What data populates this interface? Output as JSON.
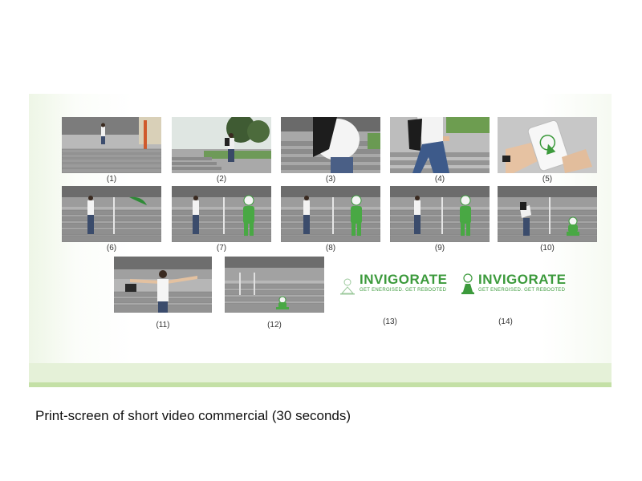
{
  "frames": [
    {
      "label": "(1)",
      "scene": "stairs-walking"
    },
    {
      "label": "(2)",
      "scene": "outdoor-backpack"
    },
    {
      "label": "(3)",
      "scene": "closeup-backpack"
    },
    {
      "label": "(4)",
      "scene": "walking-backpack"
    },
    {
      "label": "(5)",
      "scene": "phone-app"
    },
    {
      "label": "(6)",
      "scene": "stairs-standing"
    },
    {
      "label": "(7)",
      "scene": "stairs-with-mascot"
    },
    {
      "label": "(8)",
      "scene": "stairs-with-mascot"
    },
    {
      "label": "(9)",
      "scene": "stairs-with-mascot"
    },
    {
      "label": "(10)",
      "scene": "stairs-bending"
    },
    {
      "label": "(11)",
      "scene": "arms-stretched"
    },
    {
      "label": "(12)",
      "scene": "stairs-logo"
    }
  ],
  "logo_frames": [
    {
      "label": "(13)",
      "wordmark": "INVIGORATE",
      "tagline": "GET ENERGISED. GET REBOOTED"
    },
    {
      "label": "(14)",
      "wordmark": "INVIGORATE",
      "tagline": "GET ENERGISED. GET REBOOTED"
    }
  ],
  "caption": "Print-screen of short video commercial (30 seconds)",
  "colors": {
    "panel_green": "#e5f1d8",
    "brand_green": "#3c9a3c",
    "stair_grey": "#8f8f8f"
  }
}
